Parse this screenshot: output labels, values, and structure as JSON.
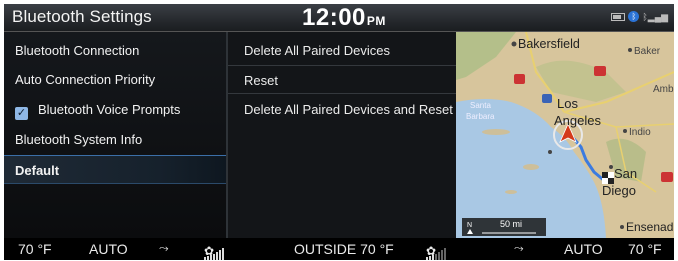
{
  "header": {
    "title": "Bluetooth Settings",
    "time": "12:00",
    "ampm": "PM",
    "status_icons": [
      "battery-icon",
      "bluetooth-icon",
      "signal-icon"
    ]
  },
  "menu": {
    "items": [
      {
        "label": "Bluetooth Connection"
      },
      {
        "label": "Auto Connection Priority"
      },
      {
        "label": "Bluetooth Voice Prompts",
        "checked": true
      },
      {
        "label": "Bluetooth System Info"
      },
      {
        "label": "Default",
        "selected": true
      }
    ]
  },
  "panel": {
    "items": [
      {
        "label": "Delete All Paired Devices"
      },
      {
        "label": "Reset"
      },
      {
        "label": "Delete All Paired Devices and Reset"
      }
    ]
  },
  "map": {
    "labels": {
      "bakersfield": "Bakersfield",
      "baker": "Baker",
      "amb": "Amb",
      "santa_barbara_1": "Santa",
      "santa_barbara_2": "Barbara",
      "los": "Los",
      "angeles": "Angeles",
      "indio": "Indio",
      "san": "San",
      "diego": "Diego",
      "ensenada": "Ensenad"
    },
    "scale": {
      "north": "N",
      "distance": "50 mi"
    },
    "colors": {
      "land": "#d9c9a3",
      "water": "#a9c9e6",
      "route": "#3b7be0"
    }
  },
  "climate": {
    "left_temp": "70 °F",
    "left_mode": "AUTO",
    "outside": "OUTSIDE  70 °F",
    "right_mode": "AUTO",
    "right_temp": "70 °F",
    "left_fan_level": 5,
    "right_fan_level": 3
  }
}
